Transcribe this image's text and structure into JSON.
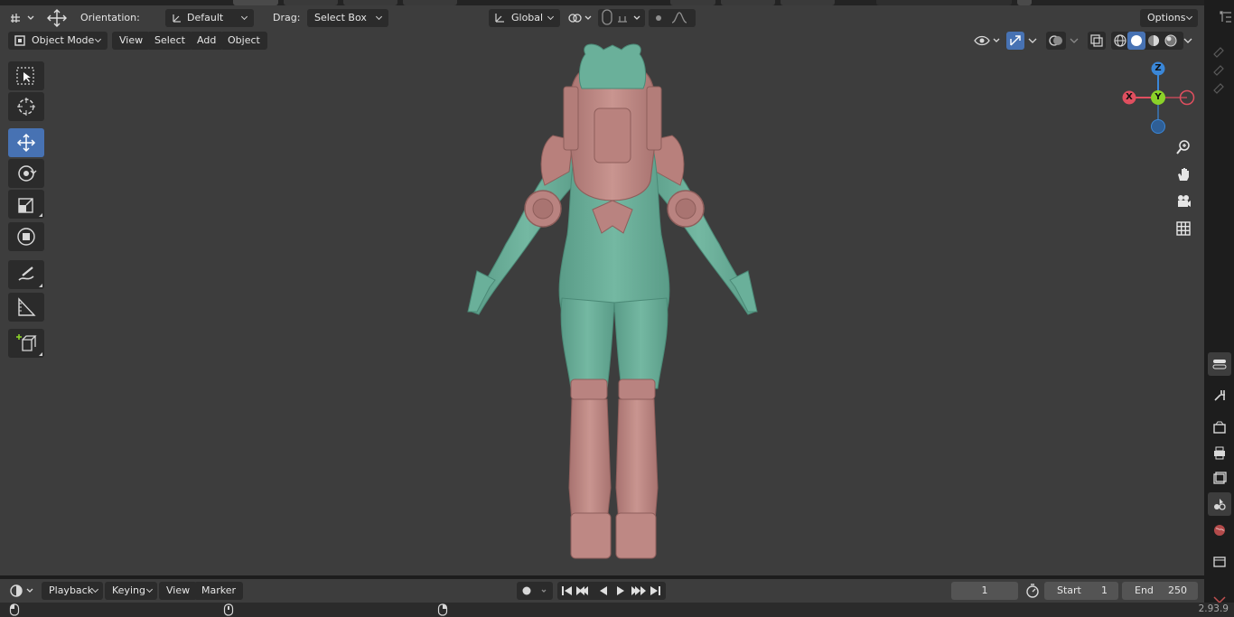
{
  "tool_header": {
    "orientation_label": "Orientation:",
    "orientation_value": "Default",
    "drag_label": "Drag:",
    "drag_value": "Select Box",
    "transform_orientation": "Global",
    "options_label": "Options"
  },
  "view_header": {
    "mode": "Object Mode",
    "menus": [
      "View",
      "Select",
      "Add",
      "Object"
    ]
  },
  "gizmo": {
    "z": "Z",
    "y": "Y",
    "x": "X"
  },
  "timeline": {
    "menus": [
      "Playback",
      "Keying",
      "View",
      "Marker"
    ],
    "current_frame": "1",
    "start_label": "Start",
    "start_value": "1",
    "end_label": "End",
    "end_value": "250"
  },
  "status": {
    "version": "2.93.9"
  },
  "colors": {
    "active_blue": "#4772b3",
    "axis_x": "#e04f5f",
    "axis_y": "#8bd229",
    "axis_z": "#3a87d8",
    "model_teal": "#6ab09a",
    "model_pink": "#c28a86"
  },
  "icons": {
    "editor_type": "viewport-editor-icon",
    "transform_pivot": "move-arrows-icon",
    "tools": [
      "select-box-icon",
      "cursor-icon",
      "move-icon",
      "rotate-icon",
      "scale-icon",
      "transform-icon",
      "annotate-icon",
      "measure-icon",
      "add-cube-icon"
    ],
    "nav": [
      "zoom-icon",
      "pan-hand-icon",
      "camera-icon",
      "grid-icon"
    ]
  }
}
